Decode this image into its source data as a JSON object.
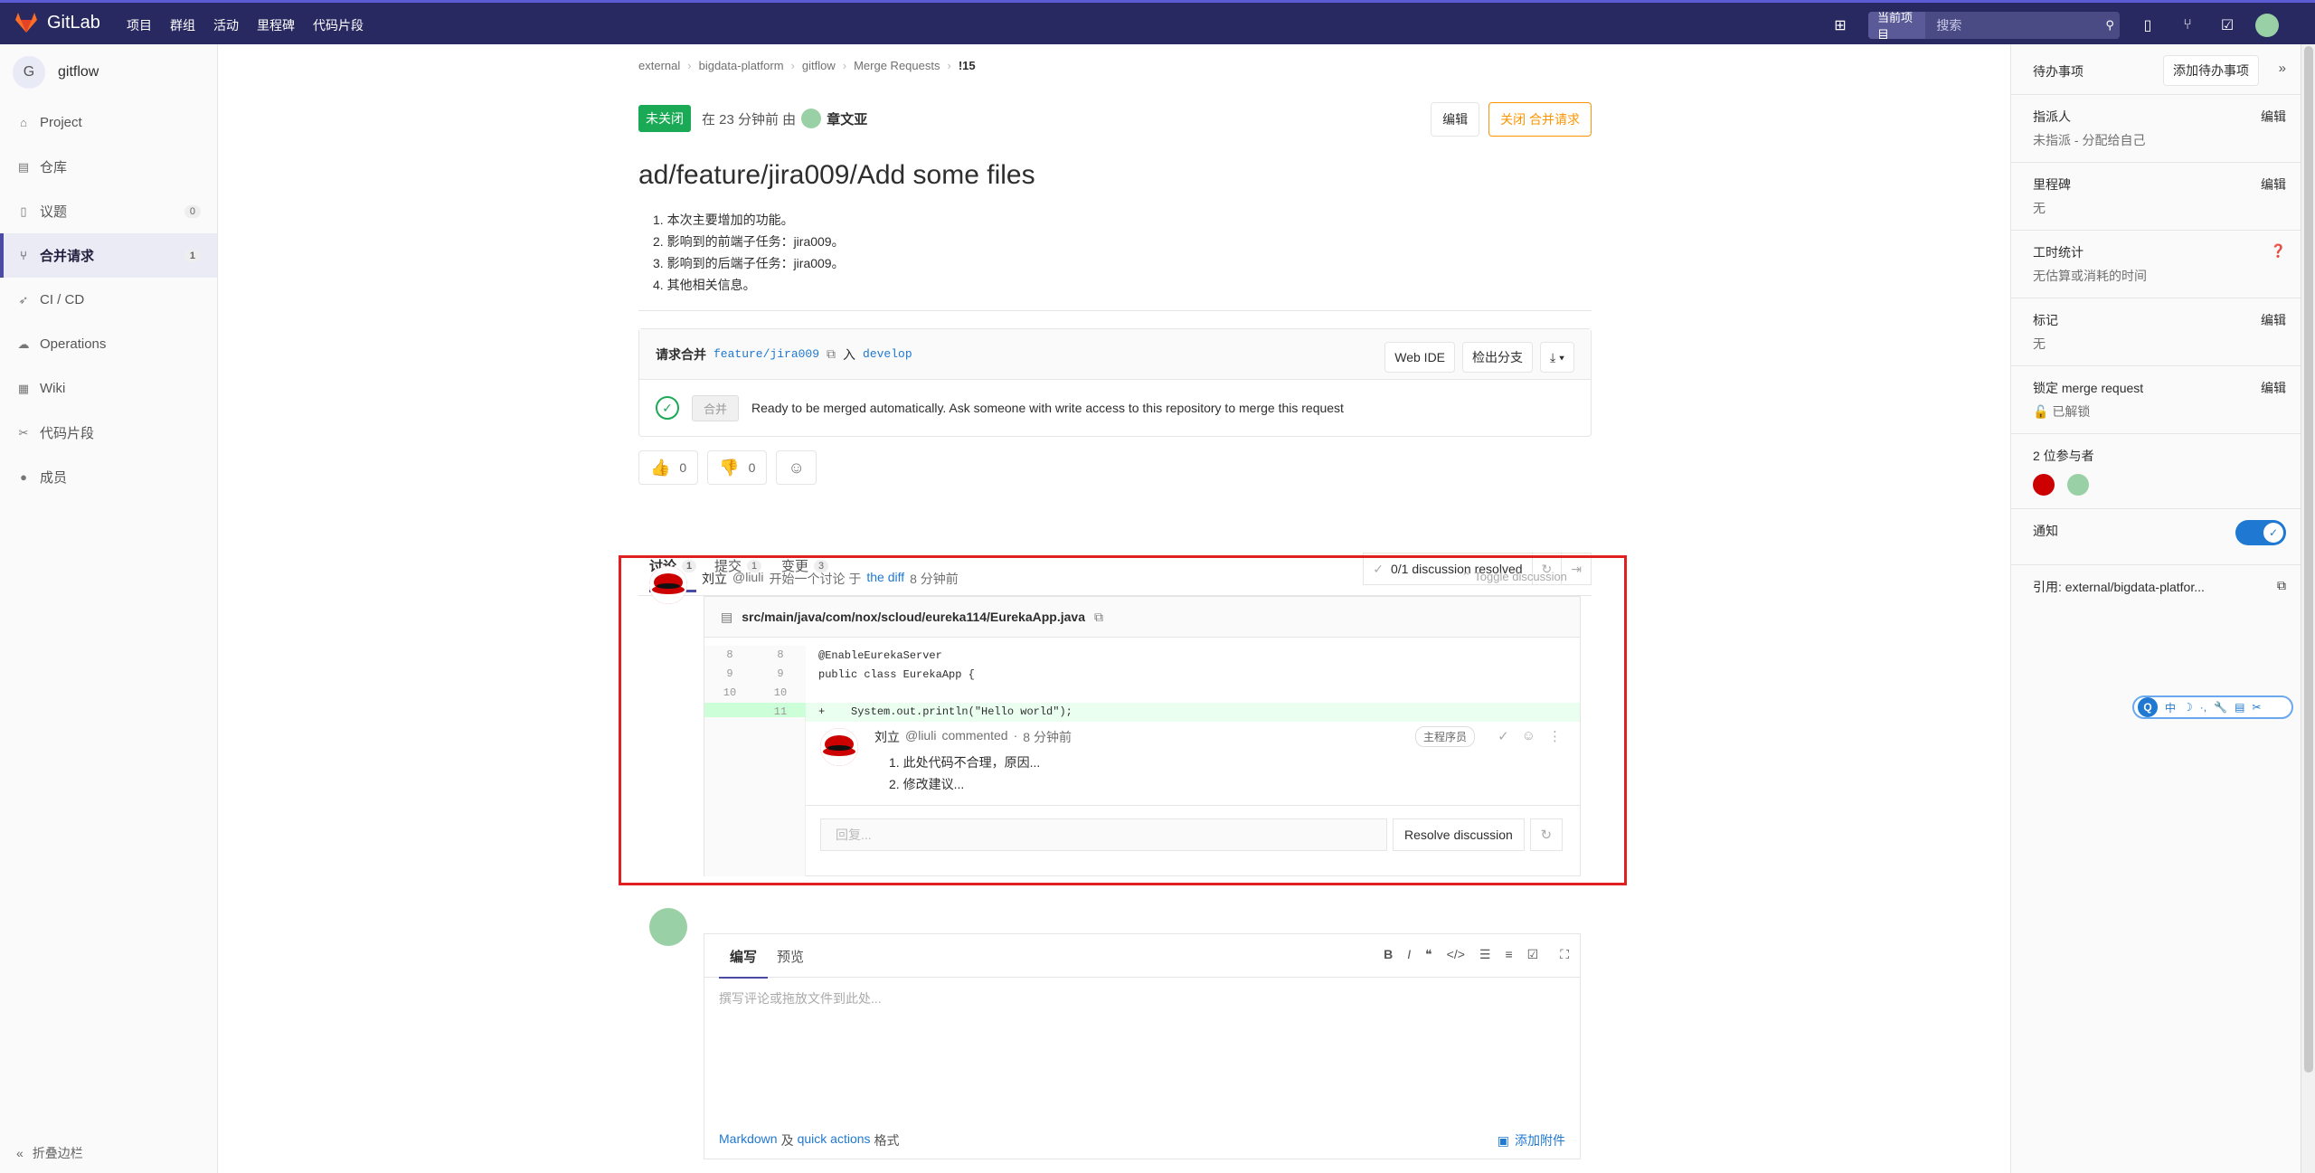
{
  "app": {
    "name": "GitLab"
  },
  "navbar": {
    "links": [
      "项目",
      "群组",
      "活动",
      "里程碑",
      "代码片段"
    ],
    "search_scope": "当前项目",
    "search_placeholder": "搜索"
  },
  "sidebar": {
    "project_initial": "G",
    "project_name": "gitflow",
    "items": [
      {
        "label": "Project",
        "icon": "home-icon"
      },
      {
        "label": "仓库",
        "icon": "book-icon"
      },
      {
        "label": "议题",
        "icon": "issues-icon",
        "count": "0"
      },
      {
        "label": "合并请求",
        "icon": "merge-request-icon",
        "count": "1",
        "active": true
      },
      {
        "label": "CI / CD",
        "icon": "rocket-icon"
      },
      {
        "label": "Operations",
        "icon": "cloud-icon"
      },
      {
        "label": "Wiki",
        "icon": "wiki-icon"
      },
      {
        "label": "代码片段",
        "icon": "scissors-icon"
      },
      {
        "label": "成员",
        "icon": "user-icon"
      }
    ],
    "collapse_label": "折叠边栏"
  },
  "breadcrumb": [
    "external",
    "bigdata-platform",
    "gitflow",
    "Merge Requests",
    "!15"
  ],
  "mr": {
    "status": "未关闭",
    "meta_prefix": "在 23 分钟前 由",
    "author": "章文亚",
    "edit_button": "编辑",
    "close_button": "关闭 合并请求",
    "title": "ad/feature/jira009/Add some files",
    "description": [
      "1. 本次主要增加的功能。",
      "2. 影响到的前端子任务：jira009。",
      "3. 影响到的后端子任务：jira009。",
      "4. 其他相关信息。"
    ]
  },
  "widget": {
    "request_merge_label": "请求合并",
    "source_branch": "feature/jira009",
    "into_label": "入",
    "target_branch": "develop",
    "web_ide": "Web IDE",
    "checkout": "检出分支",
    "merge_button": "合并",
    "status_text": "Ready to be merged automatically. Ask someone with write access to this repository to merge this request"
  },
  "awards": {
    "thumbs_up": "0",
    "thumbs_down": "0"
  },
  "tabs": [
    {
      "label": "讨论",
      "count": "1"
    },
    {
      "label": "提交",
      "count": "1"
    },
    {
      "label": "变更",
      "count": "3"
    }
  ],
  "resolved": "0/1 discussion resolved",
  "discussion": {
    "author": "刘立",
    "handle": "@liuli",
    "action": "开始一个讨论 于",
    "link": "the diff",
    "time": "8 分钟前",
    "toggle": "Toggle discussion",
    "file_path": "src/main/java/com/nox/scloud/eureka114/EurekaApp.java",
    "diff_lines": [
      {
        "old": "8",
        "new": "8",
        "code": "@EnableEurekaServer"
      },
      {
        "old": "9",
        "new": "9",
        "code": "public class EurekaApp {"
      },
      {
        "old": "10",
        "new": "10",
        "code": ""
      },
      {
        "old": "",
        "new": "11",
        "sign": "+",
        "code": "    System.out.println(\"Hello world\");"
      }
    ],
    "note": {
      "author": "刘立",
      "handle": "@liuli",
      "action": "commented",
      "sep": "·",
      "time": "8 分钟前",
      "role": "主程序员",
      "body": [
        "1. 此处代码不合理，原因...",
        "2. 修改建议..."
      ]
    },
    "reply_placeholder": "回复...",
    "resolve_button": "Resolve discussion"
  },
  "editor": {
    "tab_write": "编写",
    "tab_preview": "预览",
    "placeholder": "撰写评论或拖放文件到此处...",
    "footer": {
      "markdown": "Markdown",
      "and": "及",
      "quick_actions": "quick actions",
      "suffix": "格式"
    },
    "attach": "添加附件"
  },
  "right_sidebar": {
    "todo_label": "待办事项",
    "add_todo": "添加待办事项",
    "assignee_label": "指派人",
    "assignee_value": "未指派 - 分配给自己",
    "milestone_label": "里程碑",
    "milestone_value": "无",
    "time_label": "工时统计",
    "time_value": "无估算或消耗的时间",
    "labels_label": "标记",
    "labels_value": "无",
    "lock_label": "锁定 merge request",
    "lock_value": "已解锁",
    "participants_label": "2 位参与者",
    "notify_label": "通知",
    "reference_label": "引用:",
    "reference_value": "external/bigdata-platfor...",
    "edit_label": "编辑"
  },
  "ime": {
    "q": "Q",
    "items": [
      "中",
      "☽",
      "·,",
      "🔧",
      "▤",
      "✂"
    ]
  }
}
